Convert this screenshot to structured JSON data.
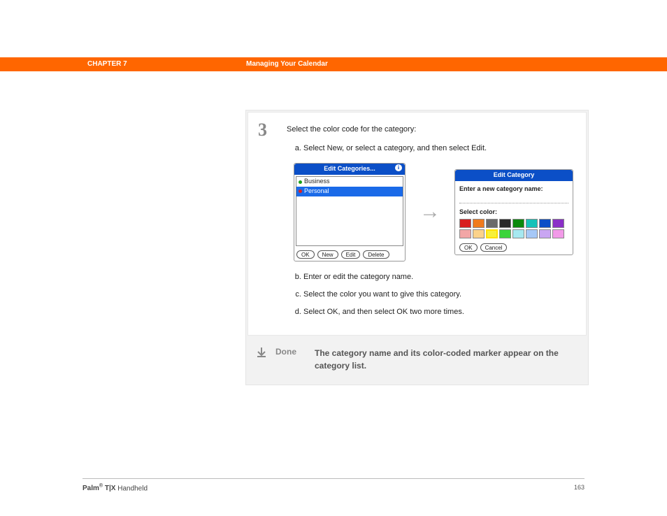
{
  "header": {
    "chapter": "CHAPTER 7",
    "title": "Managing Your Calendar"
  },
  "step": {
    "number": "3",
    "intro": "Select the color code for the category:",
    "items": [
      "Select New, or select a category, and then select Edit.",
      "Enter or edit the category name.",
      "Select the color you want to give this category.",
      "Select OK, and then select OK two more times."
    ]
  },
  "dialog1": {
    "title": "Edit Categories...",
    "categories": [
      {
        "name": "Business",
        "dot": "#1aa01a",
        "selected": false
      },
      {
        "name": "Personal",
        "dot": "#d22",
        "selected": true
      }
    ],
    "buttons": [
      "OK",
      "New",
      "Edit",
      "Delete"
    ]
  },
  "dialog2": {
    "title": "Edit Category",
    "name_label": "Enter a new category name:",
    "color_label": "Select color:",
    "colors_row1": [
      "#d81e1e",
      "#f07b1c",
      "#6b6b6b",
      "#2a2a2a",
      "#0b8a0b",
      "#17c2b8",
      "#0b4fc7",
      "#8a2fc7"
    ],
    "colors_row2": [
      "#f2a6a6",
      "#fbd28a",
      "#f7f03a",
      "#3bd43b",
      "#a6e8f0",
      "#a6c8f7",
      "#c9a6f2",
      "#f29ae8"
    ],
    "selected_index": 10,
    "buttons": [
      "OK",
      "Cancel"
    ]
  },
  "done": {
    "label": "Done",
    "text": "The category name and its color-coded marker appear on the category list."
  },
  "footer": {
    "brand": "Palm",
    "model_prefix": "T|X",
    "model_suffix": "Handheld",
    "page": "163"
  }
}
